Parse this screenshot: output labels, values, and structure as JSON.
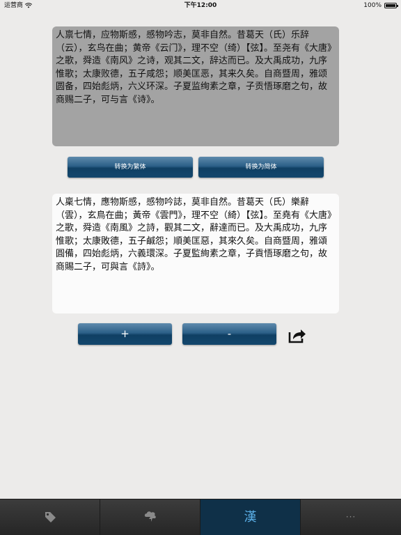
{
  "status_bar": {
    "carrier": "运营商",
    "time": "下午12:00",
    "battery": "100%"
  },
  "source_text": "人禀七情，应物斯感，感物吟志，莫非自然。昔葛天（氏）乐辞（云），玄鸟在曲；黄帝《云门》，理不空（绮）【弦】。至尧有《大唐》之歌，舜造《南风》之诗，观其二文，辞达而已。及大禹成功，九序惟歌；太康败德，五子咸怨；顺美匡恶，其来久矣。自商暨周，雅颂圆备，四始彪炳，六义环深。子夏监绚素之章，子贡悟琢磨之句，故商赐二子，可与言《诗》。",
  "result_text": "人稟七情，應物斯感，感物吟誌，莫非自然。昔葛天（氏）樂辭（雲），玄鳥在曲；黃帝《雲門》，理不空（綺）【弦】。至堯有《大唐》之歌，舜造《南風》之詩，觀其二文，辭達而已。及大禹成功，九序惟歌；太康敗德，五子鹹怨；順美匡惡，其來久矣。自商暨周，雅頌圓備，四始彪炳，六義環深。子夏監絢素之章，子貢悟琢磨之句，故商賜二子，可與言《詩》。",
  "buttons": {
    "to_traditional": "转换为繁体",
    "to_simplified": "转换为简体",
    "increase": "+",
    "decrease": "-"
  },
  "tab_bar": {
    "tabs": [
      {
        "icon": "tag-icon"
      },
      {
        "icon": "brain-lightning-icon"
      },
      {
        "label": "漢",
        "selected": true
      },
      {
        "label": "···"
      }
    ]
  },
  "colors": {
    "button_blue": "#13476d",
    "tab_selected": "#0f3048",
    "tab_active_text": "#5aaee6"
  }
}
